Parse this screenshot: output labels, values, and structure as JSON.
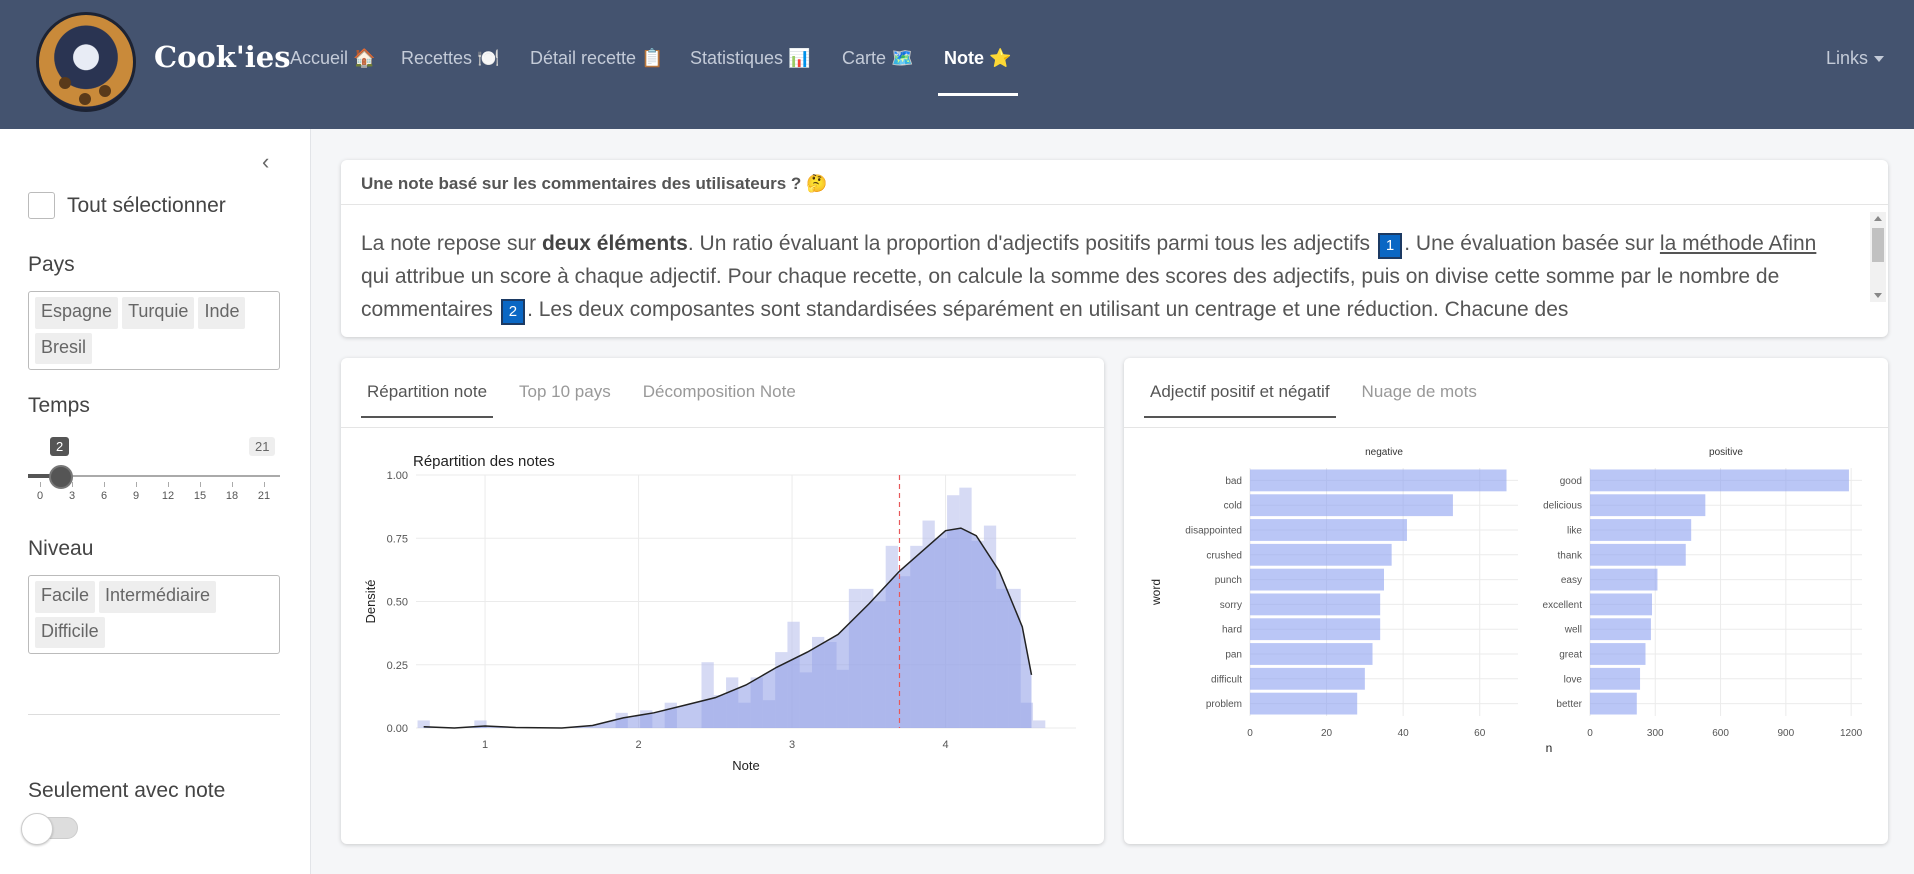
{
  "navbar": {
    "brand": "Cook'ies",
    "items": [
      {
        "label": "Accueil 🏠"
      },
      {
        "label": "Recettes 🍽️"
      },
      {
        "label": "Détail recette 📋"
      },
      {
        "label": "Statistiques 📊"
      },
      {
        "label": "Carte 🗺️"
      },
      {
        "label": "Note ⭐"
      }
    ],
    "links_label": "Links"
  },
  "sidebar": {
    "select_all_label": "Tout sélectionner",
    "pays_label": "Pays",
    "pays_tags": [
      "Espagne",
      "Turquie",
      "Inde",
      "Bresil"
    ],
    "temps_label": "Temps",
    "temps_value": "2",
    "temps_max": "21",
    "temps_ticks": [
      "0",
      "3",
      "6",
      "9",
      "12",
      "15",
      "18",
      "21"
    ],
    "niveau_label": "Niveau",
    "niveau_tags": [
      "Facile",
      "Intermédiaire",
      "Difficile"
    ],
    "note_only_label": "Seulement avec note"
  },
  "info_card": {
    "title": "Une note basé sur les commentaires des utilisateurs ? 🤔",
    "p1": "La note repose sur ",
    "p1_bold": "deux éléments",
    "p2": ". Un ratio évaluant la proportion d'adjectifs positifs parmi tous les adjectifs ",
    "badge1": "1",
    "p3": ". Une évaluation basée sur ",
    "link": "la méthode Afinn",
    "p4": " qui attribue un score à chaque adjectif. Pour chaque recette, on calcule la somme des scores des adjectifs, puis on divise cette somme par le nombre de commentaires ",
    "badge2": "2",
    "p5": ". Les deux composantes sont standardisées séparément en utilisant un centrage et une réduction. Chacune des"
  },
  "left_card": {
    "tabs": [
      "Répartition note",
      "Top 10 pays",
      "Décomposition Note"
    ]
  },
  "right_card": {
    "tabs": [
      "Adjectif positif et négatif",
      "Nuage de mots"
    ]
  },
  "chart_data": [
    {
      "type": "area",
      "title": "Répartition des notes",
      "xlabel": "Note",
      "ylabel": "Densité",
      "xlim": [
        0.55,
        4.85
      ],
      "ylim": [
        0,
        1.0
      ],
      "x_ticks": [
        1,
        2,
        3,
        4
      ],
      "y_ticks": [
        "0.00",
        "0.25",
        "0.50",
        "0.75",
        "1.00"
      ],
      "histogram": {
        "bin_width": 0.08,
        "bins": [
          [
            0.6,
            0.03
          ],
          [
            0.97,
            0.03
          ],
          [
            1.89,
            0.06
          ],
          [
            2.05,
            0.07
          ],
          [
            2.21,
            0.1
          ],
          [
            2.45,
            0.26
          ],
          [
            2.53,
            0.13
          ],
          [
            2.61,
            0.2
          ],
          [
            2.69,
            0.1
          ],
          [
            2.77,
            0.2
          ],
          [
            2.85,
            0.11
          ],
          [
            2.93,
            0.3
          ],
          [
            3.01,
            0.42
          ],
          [
            3.09,
            0.22
          ],
          [
            3.17,
            0.36
          ],
          [
            3.25,
            0.34
          ],
          [
            3.33,
            0.23
          ],
          [
            3.41,
            0.55
          ],
          [
            3.49,
            0.55
          ],
          [
            3.57,
            0.5
          ],
          [
            3.65,
            0.72
          ],
          [
            3.73,
            0.6
          ],
          [
            3.81,
            0.72
          ],
          [
            3.89,
            0.82
          ],
          [
            3.97,
            0.75
          ],
          [
            4.05,
            0.92
          ],
          [
            4.13,
            0.95
          ],
          [
            4.21,
            0.74
          ],
          [
            4.29,
            0.8
          ],
          [
            4.37,
            0.55
          ],
          [
            4.45,
            0.55
          ],
          [
            4.53,
            0.1
          ],
          [
            4.61,
            0.03
          ]
        ]
      },
      "density": [
        [
          0.6,
          0.005
        ],
        [
          0.8,
          0.0
        ],
        [
          1.0,
          0.008
        ],
        [
          1.2,
          0.002
        ],
        [
          1.5,
          0.0
        ],
        [
          1.7,
          0.01
        ],
        [
          1.9,
          0.04
        ],
        [
          2.1,
          0.06
        ],
        [
          2.3,
          0.09
        ],
        [
          2.5,
          0.12
        ],
        [
          2.7,
          0.17
        ],
        [
          2.9,
          0.24
        ],
        [
          3.1,
          0.3
        ],
        [
          3.3,
          0.37
        ],
        [
          3.5,
          0.49
        ],
        [
          3.7,
          0.62
        ],
        [
          3.85,
          0.7
        ],
        [
          4.0,
          0.78
        ],
        [
          4.1,
          0.79
        ],
        [
          4.2,
          0.76
        ],
        [
          4.35,
          0.62
        ],
        [
          4.5,
          0.4
        ],
        [
          4.56,
          0.21
        ]
      ],
      "mean_line": 3.7
    },
    {
      "type": "bar",
      "orientation": "horizontal",
      "facets": [
        {
          "title": "negative",
          "categories": [
            "bad",
            "cold",
            "disappointed",
            "crushed",
            "punch",
            "sorry",
            "hard",
            "pan",
            "difficult",
            "problem"
          ],
          "values": [
            67,
            53,
            41,
            37,
            35,
            34,
            34,
            32,
            30,
            28
          ],
          "xlim": [
            0,
            70
          ],
          "x_ticks": [
            0,
            20,
            40,
            60
          ]
        },
        {
          "title": "positive",
          "categories": [
            "good",
            "delicious",
            "like",
            "thank",
            "easy",
            "excellent",
            "well",
            "great",
            "love",
            "better"
          ],
          "values": [
            1190,
            530,
            465,
            440,
            310,
            285,
            280,
            255,
            230,
            215
          ],
          "xlim": [
            0,
            1250
          ],
          "x_ticks": [
            0,
            300,
            600,
            900,
            1200
          ]
        }
      ],
      "xlabel": "n",
      "ylabel": "word"
    }
  ]
}
